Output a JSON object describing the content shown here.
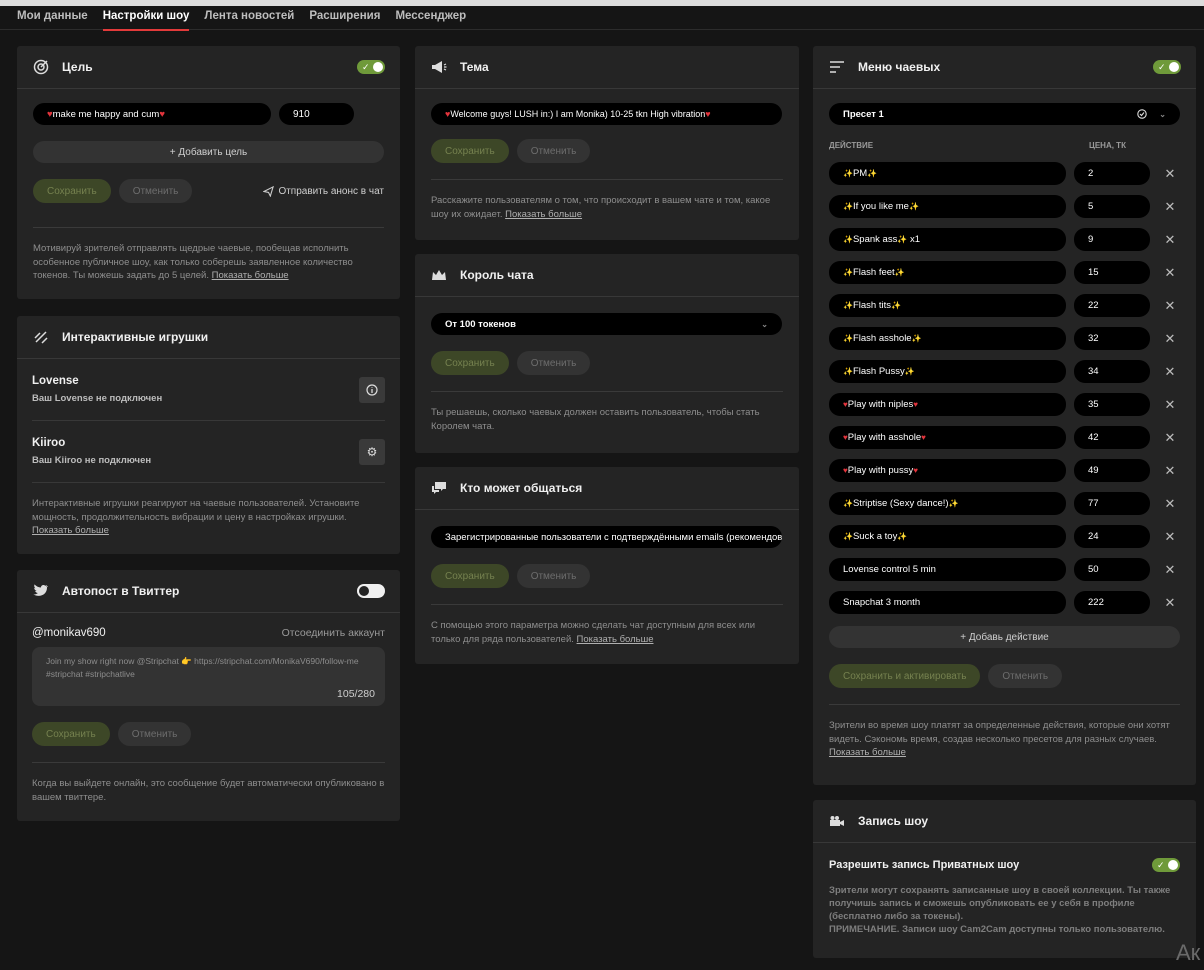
{
  "tabs": [
    "Мои данные",
    "Настройки шоу",
    "Лента новостей",
    "Расширения",
    "Мессенджер"
  ],
  "goal": {
    "title": "Цель",
    "text_pre": "♥",
    "text": "make me happy and cum",
    "text_post": "♥",
    "amount": "910",
    "add": "+ Добавить цель",
    "save": "Сохранить",
    "cancel": "Отменить",
    "announce": "Отправить анонс в чат",
    "desc": "Мотивируй зрителей отправлять щедрые чаевые, пообещав исполнить особенное публичное шоу, как только соберешь заявленное количество токенов. Ты можешь задать до 5 целей.",
    "more": "Показать больше"
  },
  "toys": {
    "title": "Интерактивные игрушки",
    "items": [
      {
        "name": "Lovense",
        "status": "Ваш Lovense не подключен"
      },
      {
        "name": "Kiiroo",
        "status": "Ваш Kiiroo не подключен"
      }
    ],
    "desc": "Интерактивные игрушки реагируют на чаевые пользователей. Установите мощность, продолжительность вибрации и цену в настройках игрушки.",
    "more": "Показать больше"
  },
  "twitter": {
    "title": "Автопост в Твиттер",
    "account": "@monikav690",
    "disconnect": "Отсоединить аккаунт",
    "message": "Join my show right now @Stripchat 👉 https://stripchat.com/MonikaV690/follow-me #stripchat #stripchatlive",
    "counter": "105/280",
    "save": "Сохранить",
    "cancel": "Отменить",
    "desc": "Когда вы выйдете онлайн, это сообщение будет автоматически опубликовано в вашем твиттере."
  },
  "topic": {
    "title": "Тема",
    "text_pre": "♥",
    "text": "Welcome guys! LUSH in:) I am Monika) 10-25 tkn High vibration",
    "text_post": "♥",
    "save": "Сохранить",
    "cancel": "Отменить",
    "desc": "Расскажите пользователям о том, что происходит в вашем чате и том, какое шоу их ожидает.",
    "more": "Показать больше"
  },
  "king": {
    "title": "Король чата",
    "select": "От 100 токенов",
    "save": "Сохранить",
    "cancel": "Отменить",
    "desc": "Ты решаешь, сколько чаевых должен оставить пользователь, чтобы стать Королем чата."
  },
  "chat": {
    "title": "Кто может общаться",
    "select": "Зарегистрированные пользователи с подтверждёнными emails (рекомендовано)",
    "save": "Сохранить",
    "cancel": "Отменить",
    "desc": "С помощью этого параметра можно сделать чат доступным для всех или только для ряда пользователей.",
    "more": "Показать больше"
  },
  "tipmenu": {
    "title": "Меню чаевых",
    "preset": "Пресет 1",
    "col_action": "ДЕЙСТВИЕ",
    "col_price": "ЦЕНА, ТК",
    "items": [
      {
        "label": "PM",
        "deco": "spark",
        "price": "2"
      },
      {
        "label": "If you like me",
        "deco": "spark",
        "price": "5"
      },
      {
        "label": "Spank ass",
        "deco": "spark",
        "suffix": " x1",
        "price": "9"
      },
      {
        "label": "Flash feet",
        "deco": "spark",
        "price": "15"
      },
      {
        "label": "Flash tits",
        "deco": "spark",
        "price": "22"
      },
      {
        "label": "Flash asshole",
        "deco": "spark",
        "price": "32"
      },
      {
        "label": "Flash Pussy",
        "deco": "spark",
        "price": "34"
      },
      {
        "label": "Play with niples",
        "deco": "heart",
        "price": "35"
      },
      {
        "label": "Play with asshole",
        "deco": "heart",
        "price": "42"
      },
      {
        "label": "Play with pussy",
        "deco": "heart",
        "price": "49"
      },
      {
        "label": "Striptise (Sexy dance!)",
        "deco": "spark",
        "price": "77"
      },
      {
        "label": "Suck a toy",
        "deco": "spark",
        "price": "24"
      },
      {
        "label": "Lovense control 5 min",
        "deco": "none",
        "price": "50"
      },
      {
        "label": "Snapchat 3 month",
        "deco": "none",
        "price": "222"
      }
    ],
    "add": "+ Добавь действие",
    "save": "Сохранить и активировать",
    "cancel": "Отменить",
    "desc": "Зрители во время шоу платят за определенные действия, которые они хотят видеть. Сэкономь время, создав несколько пресетов для разных случаев.",
    "more": "Показать больше"
  },
  "record": {
    "title": "Запись шоу",
    "label": "Разрешить запись Приватных шоу",
    "desc": "Зрители могут сохранять записанные шоу в своей коллекции. Ты также получишь запись и сможешь опубликовать ее у себя в профиле (бесплатно либо за токены).",
    "note": "ПРИМЕЧАНИЕ. Записи шоу Cam2Cam доступны только пользователю."
  },
  "corner": "Ак",
  "colors": {
    "accent": "#e23a3a",
    "toggle_on": "#6f9a3a",
    "card": "#242424",
    "bg": "#151515"
  }
}
